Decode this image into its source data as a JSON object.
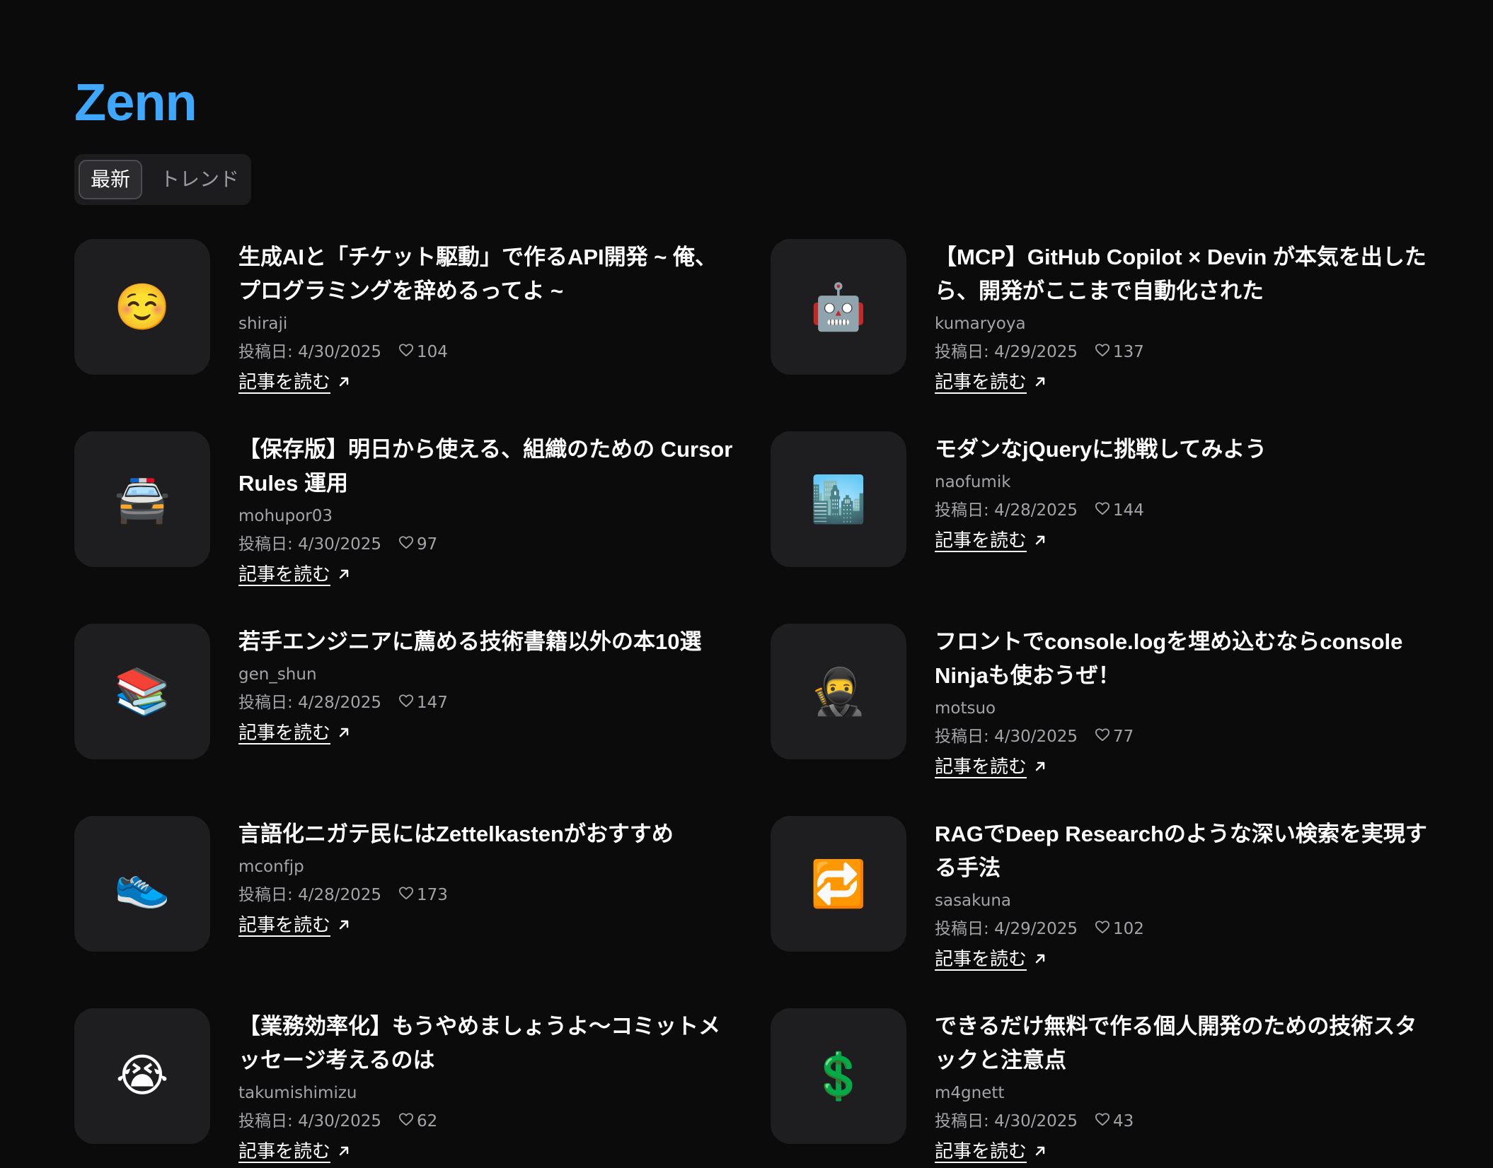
{
  "brand": "Zenn",
  "tabs": [
    "最新",
    "トレンド"
  ],
  "read_label": "記事を読む",
  "posted_prefix": "投稿日:",
  "colors": {
    "brand": "#3ea8ff",
    "background": "#0b0b0c",
    "card": "#1e1e20"
  },
  "articles": [
    {
      "title": "生成AIと「チケット駆動」で作るAPI開発 ~ 俺、プログラミングを辞めるってよ ~",
      "author": "shiraji",
      "date": "4/30/2025",
      "likes": "104",
      "emoji": "☺️"
    },
    {
      "title": "【MCP】GitHub Copilot × Devin が本気を出したら、開発がここまで自動化された",
      "author": "kumaryoya",
      "date": "4/29/2025",
      "likes": "137",
      "emoji": "🤖"
    },
    {
      "title": "【保存版】明日から使える、組織のための Cursor Rules 運用",
      "author": "mohupor03",
      "date": "4/30/2025",
      "likes": "97",
      "emoji": "🚔"
    },
    {
      "title": "モダンなjQueryに挑戦してみよう",
      "author": "naofumik",
      "date": "4/28/2025",
      "likes": "144",
      "emoji": "🏙️"
    },
    {
      "title": "若手エンジニアに薦める技術書籍以外の本10選",
      "author": "gen_shun",
      "date": "4/28/2025",
      "likes": "147",
      "emoji": "📚"
    },
    {
      "title": "フロントでconsole.logを埋め込むならconsole Ninjaも使おうぜ！",
      "author": "motsuo",
      "date": "4/30/2025",
      "likes": "77",
      "emoji": "🥷"
    },
    {
      "title": "言語化ニガテ民にはZettelkastenがおすすめ",
      "author": "mconfjp",
      "date": "4/28/2025",
      "likes": "173",
      "emoji": "👟"
    },
    {
      "title": "RAGでDeep Researchのような深い検索を実現する手法",
      "author": "sasakuna",
      "date": "4/29/2025",
      "likes": "102",
      "emoji": "🔁"
    },
    {
      "title": "【業務効率化】もうやめましょうよ〜コミットメッセージ考えるのは",
      "author": "takumishimizu",
      "date": "4/30/2025",
      "likes": "62",
      "emoji": "😭"
    },
    {
      "title": "できるだけ無料で作る個人開発のための技術スタックと注意点",
      "author": "m4gnett",
      "date": "4/30/2025",
      "likes": "43",
      "emoji": "💲"
    }
  ]
}
